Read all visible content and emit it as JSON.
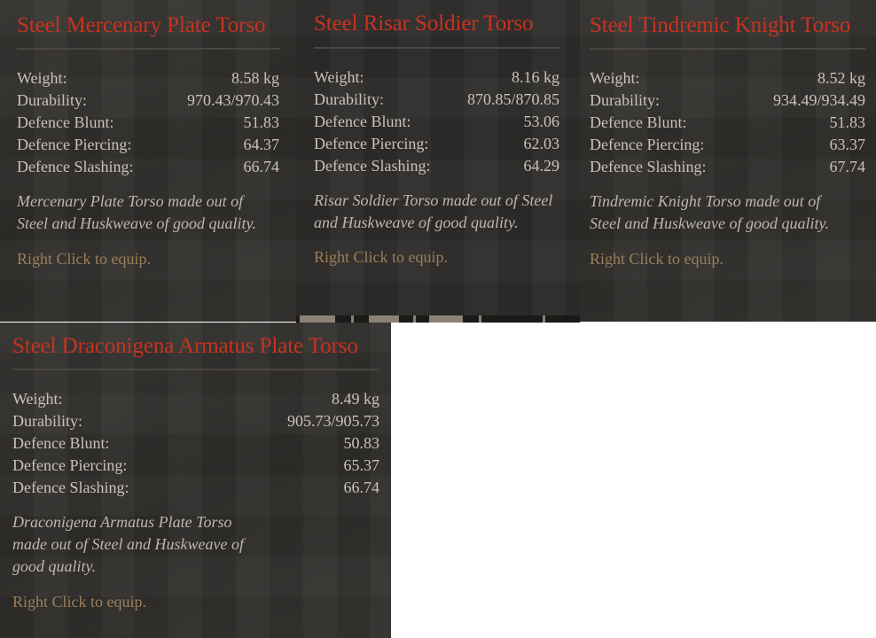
{
  "tooltips": [
    {
      "title": "Steel Mercenary Plate Torso",
      "stats": [
        {
          "label": "Weight:",
          "value": "8.58 kg"
        },
        {
          "label": "Durability:",
          "value": "970.43/970.43"
        },
        {
          "label": "Defence Blunt:",
          "value": "51.83"
        },
        {
          "label": "Defence Piercing:",
          "value": "64.37"
        },
        {
          "label": "Defence Slashing:",
          "value": "66.74"
        }
      ],
      "description": "Mercenary Plate Torso made out of Steel and Huskweave of good quality.",
      "hint": "Right Click to equip."
    },
    {
      "title": "Steel Risar Soldier Torso",
      "stats": [
        {
          "label": "Weight:",
          "value": "8.16 kg"
        },
        {
          "label": "Durability:",
          "value": "870.85/870.85"
        },
        {
          "label": "Defence Blunt:",
          "value": "53.06"
        },
        {
          "label": "Defence Piercing:",
          "value": "62.03"
        },
        {
          "label": "Defence Slashing:",
          "value": "64.29"
        }
      ],
      "description": "Risar Soldier Torso made out of Steel and Huskweave of good quality.",
      "hint": "Right Click to equip."
    },
    {
      "title": "Steel Tindremic Knight Torso",
      "stats": [
        {
          "label": "Weight:",
          "value": "8.52 kg"
        },
        {
          "label": "Durability:",
          "value": "934.49/934.49"
        },
        {
          "label": "Defence Blunt:",
          "value": "51.83"
        },
        {
          "label": "Defence Piercing:",
          "value": "63.37"
        },
        {
          "label": "Defence Slashing:",
          "value": "67.74"
        }
      ],
      "description": "Tindremic Knight Torso made out of Steel and Huskweave of good quality.",
      "hint": "Right Click to equip."
    },
    {
      "title": "Steel Draconigena Armatus Plate Torso",
      "stats": [
        {
          "label": "Weight:",
          "value": "8.49 kg"
        },
        {
          "label": "Durability:",
          "value": "905.73/905.73"
        },
        {
          "label": "Defence Blunt:",
          "value": "50.83"
        },
        {
          "label": "Defence Piercing:",
          "value": "65.37"
        },
        {
          "label": "Defence Slashing:",
          "value": "66.74"
        }
      ],
      "description": "Draconigena Armatus Plate Torso made out of Steel and Huskweave of good quality.",
      "hint": "Right Click to equip."
    }
  ],
  "colors": {
    "title": "#c8321f",
    "stat_text": "#c9c2b8",
    "hint": "#9a7f58",
    "panel_bg": "#33312e"
  }
}
